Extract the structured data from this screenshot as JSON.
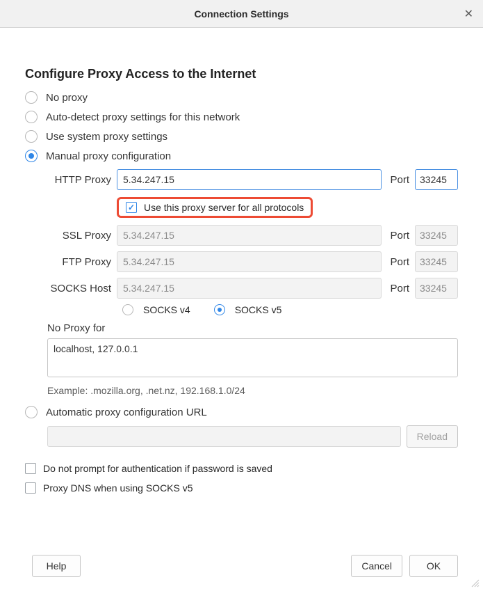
{
  "titlebar": {
    "title": "Connection Settings"
  },
  "section": {
    "heading": "Configure Proxy Access to the Internet"
  },
  "proxy_mode": {
    "no_proxy": "No proxy",
    "auto_detect": "Auto-detect proxy settings for this network",
    "system": "Use system proxy settings",
    "manual": "Manual proxy configuration",
    "pac": "Automatic proxy configuration URL"
  },
  "manual": {
    "http_label": "HTTP Proxy",
    "ssl_label": "SSL Proxy",
    "ftp_label": "FTP Proxy",
    "socks_label": "SOCKS Host",
    "port_label": "Port",
    "share_label": "Use this proxy server for all protocols",
    "http_host": "5.34.247.15",
    "http_port": "33245",
    "ssl_host": "5.34.247.15",
    "ssl_port": "33245",
    "ftp_host": "5.34.247.15",
    "ftp_port": "33245",
    "socks_host_val": "5.34.247.15",
    "socks_port": "33245",
    "socks_v4": "SOCKS v4",
    "socks_v5": "SOCKS v5"
  },
  "noproxy": {
    "label": "No Proxy for",
    "value": "localhost, 127.0.0.1",
    "example": "Example: .mozilla.org, .net.nz, 192.168.1.0/24"
  },
  "pac": {
    "url": "",
    "reload": "Reload"
  },
  "options": {
    "no_prompt": "Do not prompt for authentication if password is saved",
    "proxy_dns": "Proxy DNS when using SOCKS v5"
  },
  "buttons": {
    "help": "Help",
    "cancel": "Cancel",
    "ok": "OK"
  }
}
